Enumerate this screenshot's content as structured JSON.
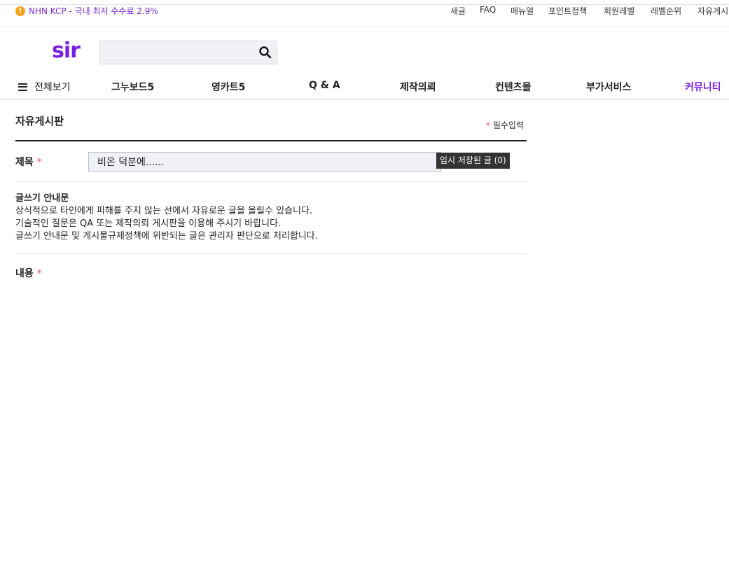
{
  "notice": {
    "icon": "exclamation-icon",
    "icon_glyph": "!",
    "text": "NHN KCP - 국내 최저 수수료 2.9%"
  },
  "top_links": [
    "새글",
    "FAQ",
    "매뉴얼",
    "포인트정책",
    "회원레벨",
    "레벨순위",
    "자유게시"
  ],
  "logo": {
    "text": "sir"
  },
  "search": {
    "value": "",
    "placeholder": "",
    "icon": "search-icon"
  },
  "gnb": {
    "all_label": "전체보기",
    "menu_icon": "hamburger-icon",
    "items": [
      "그누보드5",
      "영카트5",
      "Q & A",
      "제작의뢰",
      "컨텐츠몰",
      "부가서비스",
      "커뮤니티"
    ]
  },
  "board": {
    "title": "자유게시판",
    "required_star": "*",
    "required_text": "필수입력",
    "subject_label": "제목",
    "subject_value": "비온 덕분에......",
    "draft_button": "임시 저장된 글 (0)",
    "guide_title": "글쓰기 안내문",
    "guide_lines": [
      "상식적으로 타인에게 피해를 주지 않는 선에서 자유로운 글을 올릴수 있습니다.",
      "기술적인 질문은 QA 또는 제작의뢰 게시판을 이용해 주시기 바랍니다.",
      "글쓰기 안내문 및 게시물규제정책에 위반되는 글은 관리자 판단으로 처리합니다."
    ],
    "content_label": "내용"
  },
  "colors": {
    "brand": "#7a1fe0",
    "required": "#e2574c",
    "notice_icon": "#f4a21a",
    "draft_button_bg": "#333333"
  }
}
